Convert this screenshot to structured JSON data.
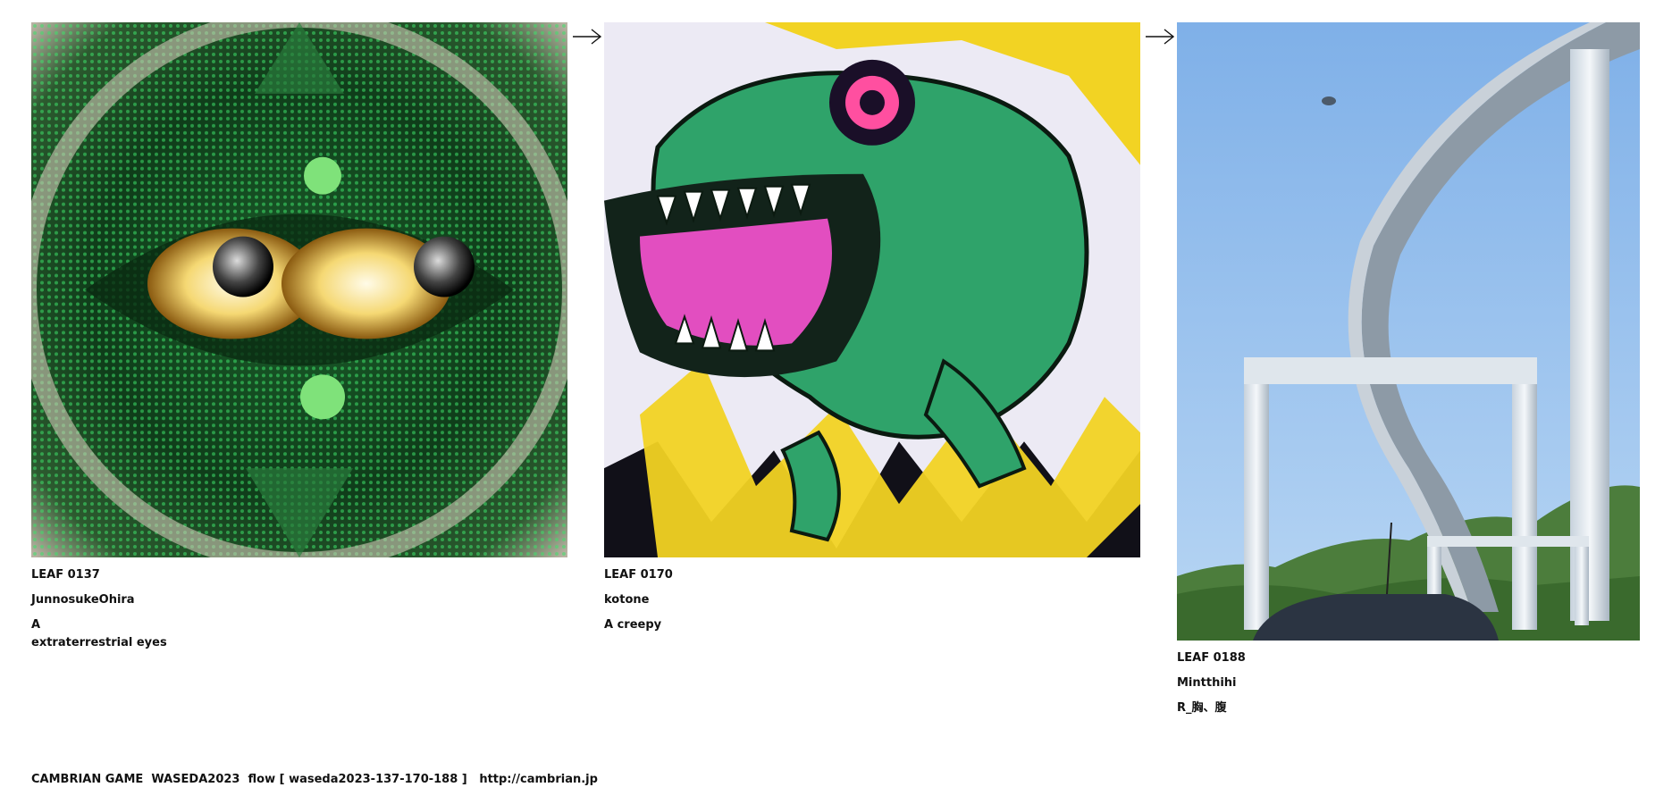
{
  "leaves": [
    {
      "id": "LEAF 0137",
      "author": "JunnosukeOhira",
      "description_lines": [
        "A",
        "extraterrestrial eyes"
      ],
      "image_subject": "green reptilian mirrored pattern with two golden eyes"
    },
    {
      "id": "LEAF 0170",
      "author": "kotone",
      "description_lines": [
        "A creepy"
      ],
      "image_subject": "green cartoon dinosaur with pink tongue on yellow and black background"
    },
    {
      "id": "LEAF 0188",
      "author": "Mintthihi",
      "description_lines": [
        "R_胸、腹"
      ],
      "image_subject": "curving elevated highway with white pillars under blue sky"
    }
  ],
  "arrows": [
    "arrow-right-icon",
    "arrow-right-icon"
  ],
  "footer": {
    "text": "CAMBRIAN GAME  WASEDA2023  flow [ waseda2023-137-170-188 ]   ",
    "link": "http://cambrian.jp"
  }
}
